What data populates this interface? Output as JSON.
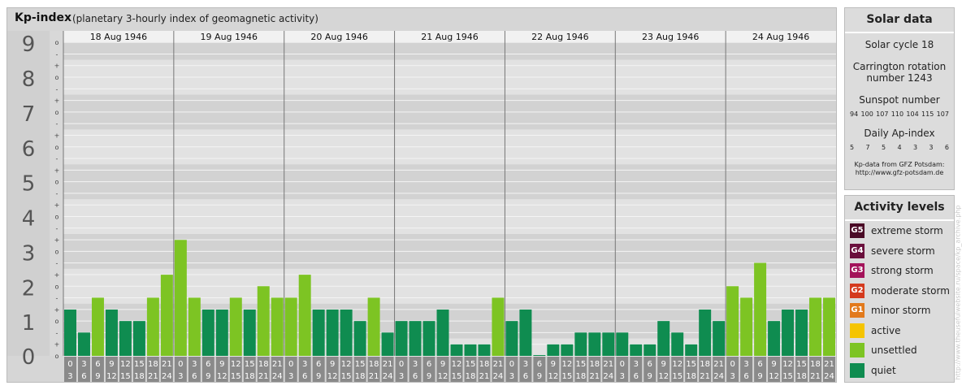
{
  "header": {
    "title": "Kp-index",
    "subtitle": "(planetary 3-hourly index of geomagnetic activity)"
  },
  "colors": {
    "quiet": "#0f8c50",
    "unsettled": "#7dc423",
    "active": "#f5c400",
    "minor_storm": "#e27a1c",
    "moderate_storm": "#d43a1e",
    "strong_storm": "#a3135a",
    "severe_storm": "#6a0f3c",
    "extreme_storm": "#4a0a26"
  },
  "chart_data": {
    "type": "bar",
    "title": "Kp-index",
    "ylim": [
      0,
      9
    ],
    "y_ticks": [
      "0",
      "1",
      "2",
      "3",
      "4",
      "5",
      "6",
      "7",
      "8",
      "9"
    ],
    "sub_ticks": [
      "o",
      "+",
      "-"
    ],
    "days": [
      "18 Aug 1946",
      "19 Aug 1946",
      "20 Aug 1946",
      "21 Aug 1946",
      "22 Aug 1946",
      "23 Aug 1946",
      "24 Aug 1946"
    ],
    "interval_labels": [
      [
        "0",
        "3"
      ],
      [
        "3",
        "6"
      ],
      [
        "6",
        "9"
      ],
      [
        "9",
        "12"
      ],
      [
        "12",
        "15"
      ],
      [
        "15",
        "18"
      ],
      [
        "18",
        "21"
      ],
      [
        "21",
        "24"
      ]
    ],
    "values": [
      1.33,
      0.67,
      1.67,
      1.33,
      1.0,
      1.0,
      1.67,
      2.33,
      3.33,
      1.67,
      1.33,
      1.33,
      1.67,
      1.33,
      2.0,
      1.67,
      1.67,
      2.33,
      1.33,
      1.33,
      1.33,
      1.0,
      1.67,
      0.67,
      1.0,
      1.0,
      1.0,
      1.33,
      0.33,
      0.33,
      0.33,
      1.67,
      1.0,
      1.33,
      0.0,
      0.33,
      0.33,
      0.67,
      0.67,
      0.67,
      0.67,
      0.33,
      0.33,
      1.0,
      0.67,
      0.33,
      1.33,
      1.0,
      2.0,
      1.67,
      2.67,
      1.0,
      1.33,
      1.33,
      1.67,
      1.67
    ],
    "grid": true
  },
  "solar": {
    "title": "Solar data",
    "cycle": "Solar cycle 18",
    "carrington_line1": "Carrington rotation",
    "carrington_line2": "number 1243",
    "sunspot_title": "Sunspot number",
    "sunspots": [
      "94",
      "100",
      "107",
      "110",
      "104",
      "115",
      "107"
    ],
    "ap_title": "Daily Ap-index",
    "ap_values": [
      "5",
      "7",
      "5",
      "4",
      "3",
      "3",
      "6"
    ],
    "credit_line1": "Kp-data from GFZ Potsdam:",
    "credit_line2": "http://www.gfz-potsdam.de"
  },
  "activity": {
    "title": "Activity levels",
    "levels": [
      {
        "badge": "G5",
        "label": "extreme storm",
        "color": "#4a0a26"
      },
      {
        "badge": "G4",
        "label": "severe storm",
        "color": "#6a0f3c"
      },
      {
        "badge": "G3",
        "label": "strong storm",
        "color": "#a3135a"
      },
      {
        "badge": "G2",
        "label": "moderate storm",
        "color": "#d43a1e"
      },
      {
        "badge": "G1",
        "label": "minor storm",
        "color": "#e27a1c"
      },
      {
        "badge": "",
        "label": "active",
        "color": "#f5c400"
      },
      {
        "badge": "",
        "label": "unsettled",
        "color": "#7dc423"
      },
      {
        "badge": "",
        "label": "quiet",
        "color": "#0f8c50"
      }
    ]
  },
  "watermark": "http://www.theusefulwebsite.ru/space/kp_archive.php"
}
